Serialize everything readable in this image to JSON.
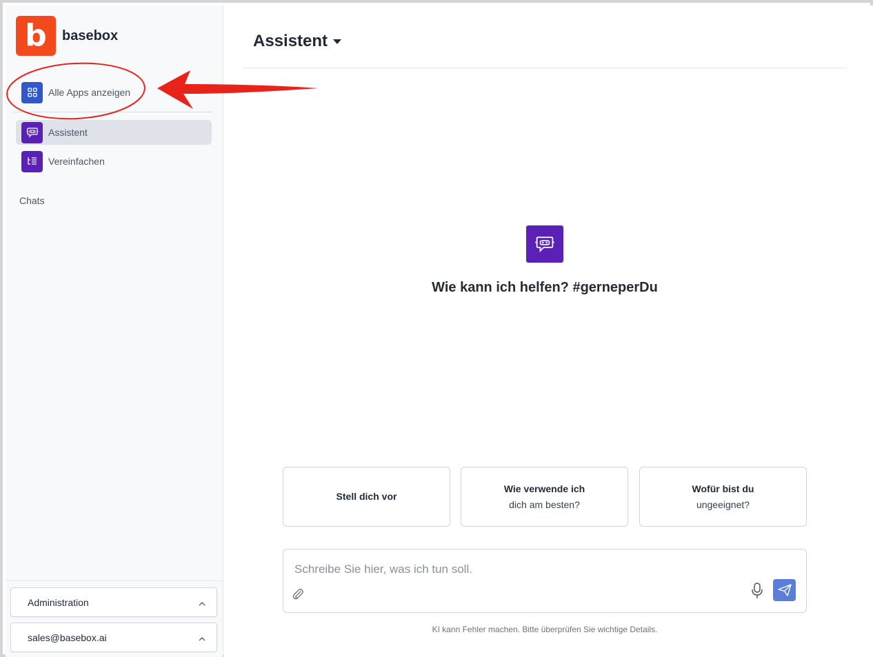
{
  "brand": {
    "logo_letter": "b",
    "name": "basebox",
    "accent": "#f34a1d"
  },
  "sidebar": {
    "all_apps": {
      "label": "Alle Apps anzeigen",
      "icon": "grid-icon",
      "color": "#2f58cd"
    },
    "apps": [
      {
        "label": "Assistent",
        "icon": "robot-chat-icon",
        "active": true,
        "color": "#5b21b6"
      },
      {
        "label": "Vereinfachen",
        "icon": "list-simplify-icon",
        "active": false,
        "color": "#5b21b6"
      }
    ],
    "chats_label": "Chats",
    "bottom": {
      "administration": "Administration",
      "account": "sales@basebox.ai"
    }
  },
  "header": {
    "title": "Assistent"
  },
  "hero": {
    "icon": "robot-chat-icon",
    "text": "Wie kann ich helfen? #gerneperDu"
  },
  "suggestions": [
    {
      "line1": "Stell dich vor",
      "line2": ""
    },
    {
      "line1": "Wie verwende ich",
      "line2": "dich am besten?"
    },
    {
      "line1": "Wofür bist du",
      "line2": "ungeeignet?"
    }
  ],
  "composer": {
    "placeholder": "Schreibe Sie hier, was ich tun soll.",
    "value": ""
  },
  "footer_note": "KI kann Fehler machen. Bitte überprüfen Sie wichtige Details.",
  "annotation": {
    "color": "#e8231a",
    "shapes": [
      "circle",
      "arrow"
    ]
  }
}
